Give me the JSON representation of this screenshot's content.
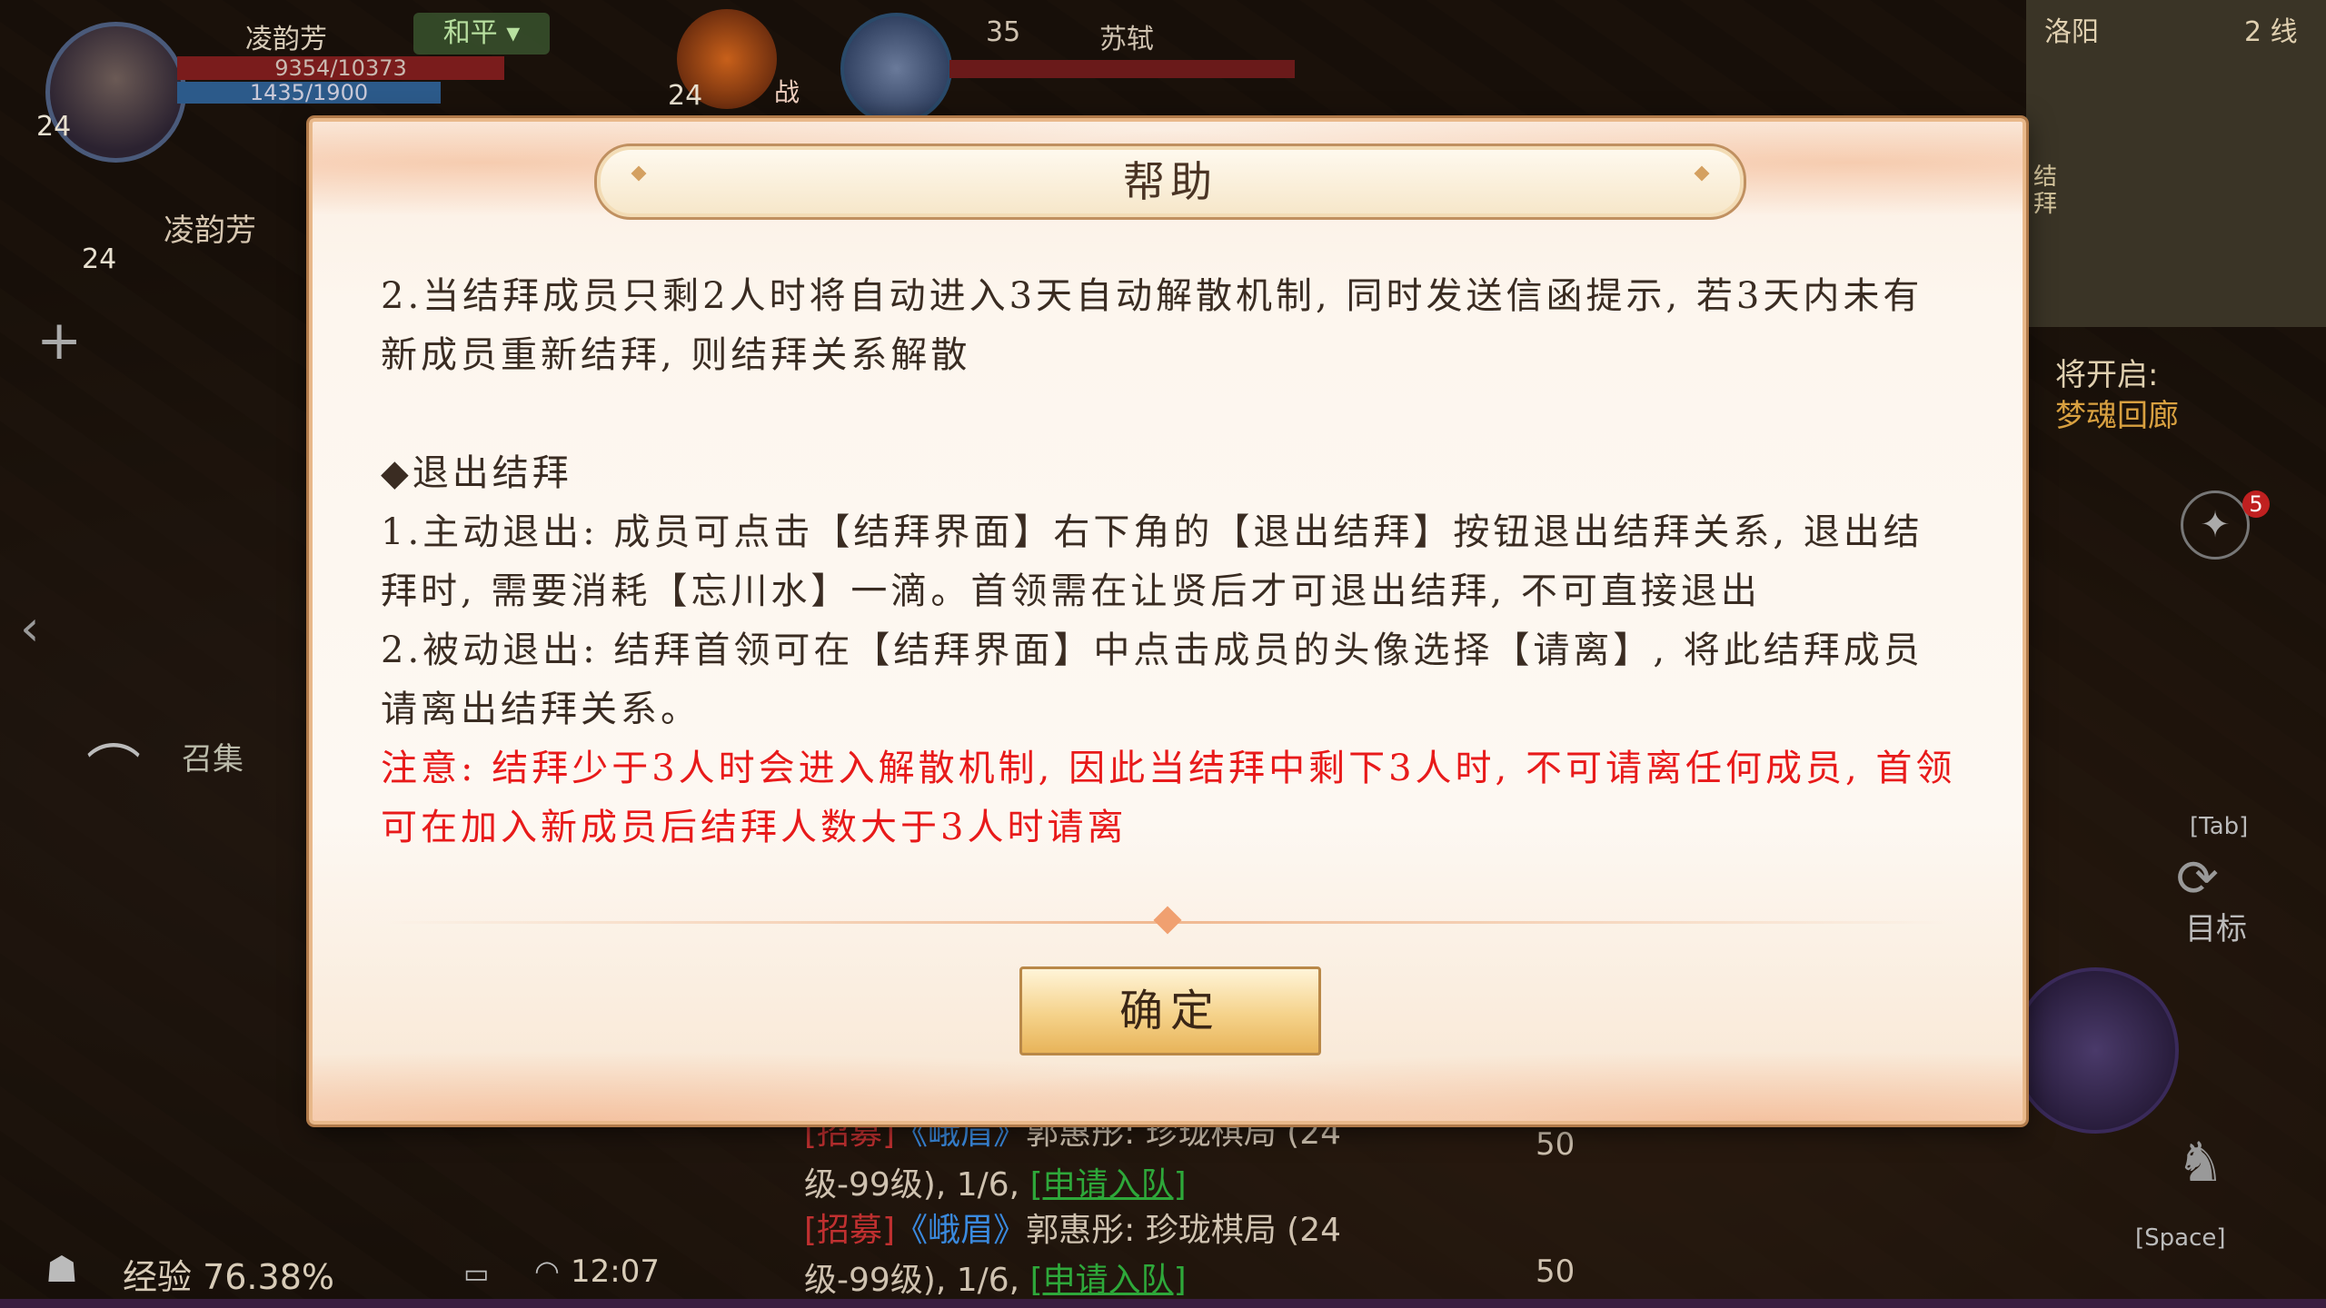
{
  "hud": {
    "player_level": "24",
    "player_name": "凌韵芳",
    "pk_mode": "和平",
    "hp": "9354/10373",
    "mp": "1435/1900",
    "pet_level": "24",
    "pet_status": "战",
    "target_level": "35",
    "target_name": "苏轼",
    "team_level": "24",
    "team_member_name": "凌韵芳",
    "map_city": "洛阳",
    "map_line": "2 线",
    "map_side_label": "结拜",
    "quest_label": "将开启:",
    "quest_target": "梦魂回廊",
    "quest_badge": "5",
    "summon_label": "召集",
    "tab_hint": "[Tab]",
    "target_button": "目标",
    "space_hint": "[Space]",
    "exp_label": "经验 76.38%",
    "clock": "12:07",
    "chat": [
      {
        "tag": "[招募]",
        "sect": "《峨眉》",
        "name": "郭惠彤:",
        "text": "珍珑棋局 (24"
      },
      {
        "text": "级-99级), 1/6,",
        "link": "[申请入队]"
      },
      {
        "tag": "[招募]",
        "sect": "《峨眉》",
        "name": "郭惠彤:",
        "text": "珍珑棋局 (24"
      },
      {
        "text": "级-99级), 1/6,",
        "link": "[申请入队]"
      }
    ],
    "chat_counts": [
      "50",
      "50"
    ]
  },
  "dialog": {
    "title": "帮助",
    "paragraphs": [
      "2.当结拜成员只剩2人时将自动进入3天自动解散机制, 同时发送信函提示, 若3天内未有新成员重新结拜, 则结拜关系解散",
      "◆退出结拜",
      "1.主动退出: 成员可点击【结拜界面】右下角的【退出结拜】按钮退出结拜关系, 退出结拜时, 需要消耗【忘川水】一滴。首领需在让贤后才可退出结拜, 不可直接退出",
      "2.被动退出: 结拜首领可在【结拜界面】中点击成员的头像选择【请离】, 将此结拜成员请离出结拜关系。"
    ],
    "warning": "注意: 结拜少于3人时会进入解散机制, 因此当结拜中剩下3人时, 不可请离任何成员, 首领可在加入新成员后结拜人数大于3人时请离",
    "confirm_label": "确定",
    "warning_color": "#e81a1a",
    "accent_color": "#e8b88a"
  }
}
